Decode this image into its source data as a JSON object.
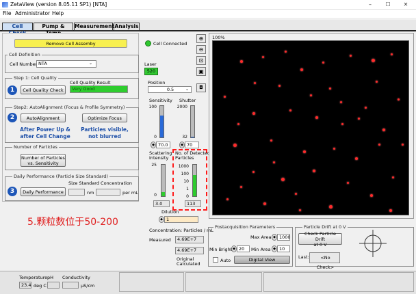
{
  "window": {
    "title": "ZetaView (version 8.05.11 SP1) [NTA]",
    "controls": [
      "–",
      "☐",
      "✕"
    ]
  },
  "menu": [
    "File",
    "Administrator",
    "Help"
  ],
  "tabs": [
    "Cell Check",
    "Pump & Temp",
    "Measurement",
    "Analysis"
  ],
  "remove_cell_button": "Remove Cell Assemby",
  "cell_connected": "Cell Connected",
  "cell_definition": {
    "group": "Cell Definition",
    "label": "Cell Number",
    "value": "NTA"
  },
  "step1": {
    "group": "Step 1: Cell Quality",
    "number": "1",
    "button": "Cell Quality Check",
    "result_label": "Cell Quality Result",
    "result_value": "Very Good"
  },
  "step2": {
    "group": "Step2: AutoAlignment (Focus & Profile Symmetry)",
    "number": "2",
    "button1": "AutoAlignment",
    "button2": "Optimize Focus",
    "note1": "After Power Up &\nafter Cell Change",
    "note2": "Particles visible,\nnot blurred"
  },
  "particles": {
    "group": "Number of Particles",
    "button": "Number of Particles\nvs. Sensitivity"
  },
  "daily": {
    "group": "Daily Performance (Particle Size Standard)",
    "number": "3",
    "button": "Daily Performance",
    "std_label": "Size Standard Concentration",
    "unit1": "nm",
    "unit2": "per mL"
  },
  "laser": {
    "label": "Laser",
    "value": "520"
  },
  "position": {
    "label": "Position",
    "value": "0.5"
  },
  "sensitivity": {
    "label": "Sensitivity",
    "ticks": [
      "100",
      "0"
    ],
    "value": "70.0",
    "level": 0.7
  },
  "shutter": {
    "label": "Shutter",
    "ticks": [
      "2000",
      "32",
      "0"
    ],
    "value": "70",
    "level": 0.03
  },
  "scattering": {
    "label": "Scattering\nIntensity",
    "ticks": [
      "25",
      "0"
    ],
    "value": "3.0",
    "level": 0.12
  },
  "detected": {
    "label": "No. of Detected\nParticles",
    "ticks": [
      "1000",
      "100",
      "10",
      "1",
      "0"
    ],
    "value": "113",
    "level": 0.68
  },
  "dilution": {
    "label": "Dilution",
    "value": "1"
  },
  "concentration": {
    "label": "Concentration: Particles / mL",
    "measured_label": "Measured",
    "measured": "4.69E+7",
    "original": "4.69E+7",
    "original_label": "Original\nCalculated"
  },
  "viewer": {
    "zoom": "100%",
    "tools": [
      "zoom-in",
      "zoom-out",
      "zoom-fit",
      "save",
      "camera"
    ]
  },
  "postacq": {
    "group": "Postacquisition Parameters",
    "max_area_label": "Max Area",
    "max_area": "1000",
    "min_bright_label": "Min Bright.",
    "min_bright": "20",
    "min_area_label": "Min Area",
    "min_area": "10",
    "auto_label": "Auto",
    "digital_button": "Digital View"
  },
  "drift": {
    "group": "Particle Drift at 0 V",
    "button": "Check Particle Drift\nat 0 V",
    "last_label": "Last:",
    "last_value": "<No Check>"
  },
  "status": {
    "temp_label": "Temperature",
    "temp": "23.4",
    "temp_unit": "deg C",
    "ph_label": "pH",
    "cond_label": "Conductivity",
    "cond_unit": "µS/cm"
  },
  "caption": "5.颗粒数位于50-200",
  "colors": {
    "tab_active": "#cfe0f5",
    "remove_button": "#f8f050",
    "quality_result": "#2ecc2e",
    "laser": "#32c832",
    "annotation": "#ff1a1a",
    "slider_blue": "#2a6ad8",
    "slider_green": "#2ecb2e"
  }
}
